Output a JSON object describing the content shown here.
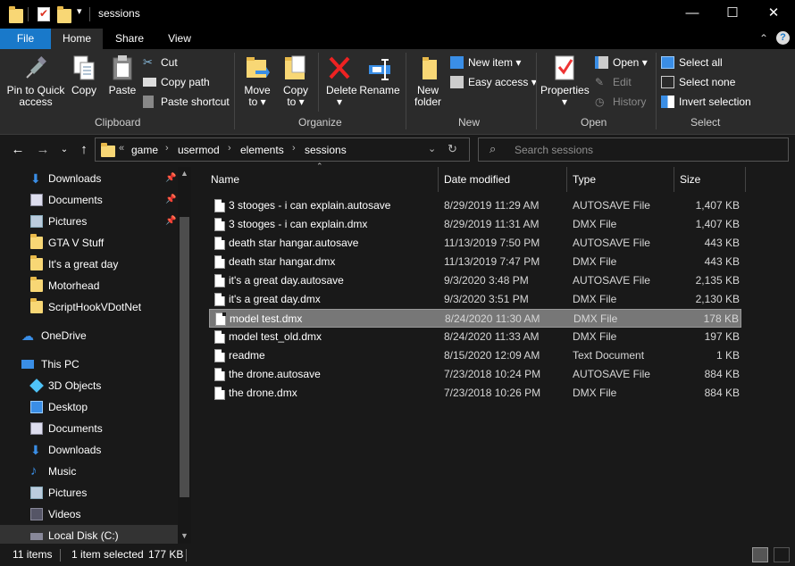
{
  "window": {
    "title": "sessions",
    "minimize": "—",
    "maximize": "☐",
    "close": "✕"
  },
  "ribbon_tabs": [
    "File",
    "Home",
    "Share",
    "View"
  ],
  "ribbon": {
    "clipboard": {
      "label": "Clipboard",
      "pin_to_quick_access": "Pin to Quick access",
      "copy": "Copy",
      "paste": "Paste",
      "cut": "Cut",
      "copy_path": "Copy path",
      "paste_shortcut": "Paste shortcut"
    },
    "organize": {
      "label": "Organize",
      "move_to": "Move to ▾",
      "copy_to": "Copy to ▾",
      "delete": "Delete ▾",
      "rename": "Rename"
    },
    "new": {
      "label": "New",
      "new_folder": "New folder",
      "new_item": "New item ▾",
      "easy_access": "Easy access ▾"
    },
    "open": {
      "label": "Open",
      "properties": "Properties ▾",
      "open": "Open ▾",
      "edit": "Edit",
      "history": "History"
    },
    "select": {
      "label": "Select",
      "select_all": "Select all",
      "select_none": "Select none",
      "invert_selection": "Invert selection"
    }
  },
  "address": {
    "overflow": "«",
    "crumbs": [
      "game",
      "usermod",
      "elements",
      "sessions"
    ],
    "search_placeholder": "Search sessions"
  },
  "nav_pane": {
    "quick_access": [
      {
        "label": "Downloads",
        "pinned": true
      },
      {
        "label": "Documents",
        "pinned": true
      },
      {
        "label": "Pictures",
        "pinned": true
      },
      {
        "label": "GTA V Stuff",
        "pinned": false
      },
      {
        "label": "It's a great day",
        "pinned": false
      },
      {
        "label": "Motorhead",
        "pinned": false
      },
      {
        "label": "ScriptHookVDotNet",
        "pinned": false
      }
    ],
    "onedrive": "OneDrive",
    "this_pc": "This PC",
    "this_pc_items": [
      "3D Objects",
      "Desktop",
      "Documents",
      "Downloads",
      "Music",
      "Pictures",
      "Videos",
      "Local Disk (C:)"
    ]
  },
  "file_list": {
    "columns": {
      "name": "Name",
      "date": "Date modified",
      "type": "Type",
      "size": "Size"
    },
    "rows": [
      {
        "name": "3 stooges - i can explain.autosave",
        "date": "8/29/2019 11:29 AM",
        "type": "AUTOSAVE File",
        "size": "1,407 KB"
      },
      {
        "name": "3 stooges - i can explain.dmx",
        "date": "8/29/2019 11:31 AM",
        "type": "DMX File",
        "size": "1,407 KB"
      },
      {
        "name": "death star hangar.autosave",
        "date": "11/13/2019 7:50 PM",
        "type": "AUTOSAVE File",
        "size": "443 KB"
      },
      {
        "name": "death star hangar.dmx",
        "date": "11/13/2019 7:47 PM",
        "type": "DMX File",
        "size": "443 KB"
      },
      {
        "name": "it's a great day.autosave",
        "date": "9/3/2020 3:48 PM",
        "type": "AUTOSAVE File",
        "size": "2,135 KB"
      },
      {
        "name": "it's a great day.dmx",
        "date": "9/3/2020 3:51 PM",
        "type": "DMX File",
        "size": "2,130 KB"
      },
      {
        "name": "model test.dmx",
        "date": "8/24/2020 11:30 AM",
        "type": "DMX File",
        "size": "178 KB"
      },
      {
        "name": "model test_old.dmx",
        "date": "8/24/2020 11:33 AM",
        "type": "DMX File",
        "size": "197 KB"
      },
      {
        "name": "readme",
        "date": "8/15/2020 12:09 AM",
        "type": "Text Document",
        "size": "1 KB"
      },
      {
        "name": "the drone.autosave",
        "date": "7/23/2018 10:24 PM",
        "type": "AUTOSAVE File",
        "size": "884 KB"
      },
      {
        "name": "the drone.dmx",
        "date": "7/23/2018 10:26 PM",
        "type": "DMX File",
        "size": "884 KB"
      }
    ],
    "selected_index": 6
  },
  "status": {
    "item_count": "11 items",
    "selection": "1 item selected",
    "selection_size": "177 KB"
  },
  "colors": {
    "accent": "#1979ca",
    "selected_row": "#777777",
    "folder": "#f8d775"
  }
}
